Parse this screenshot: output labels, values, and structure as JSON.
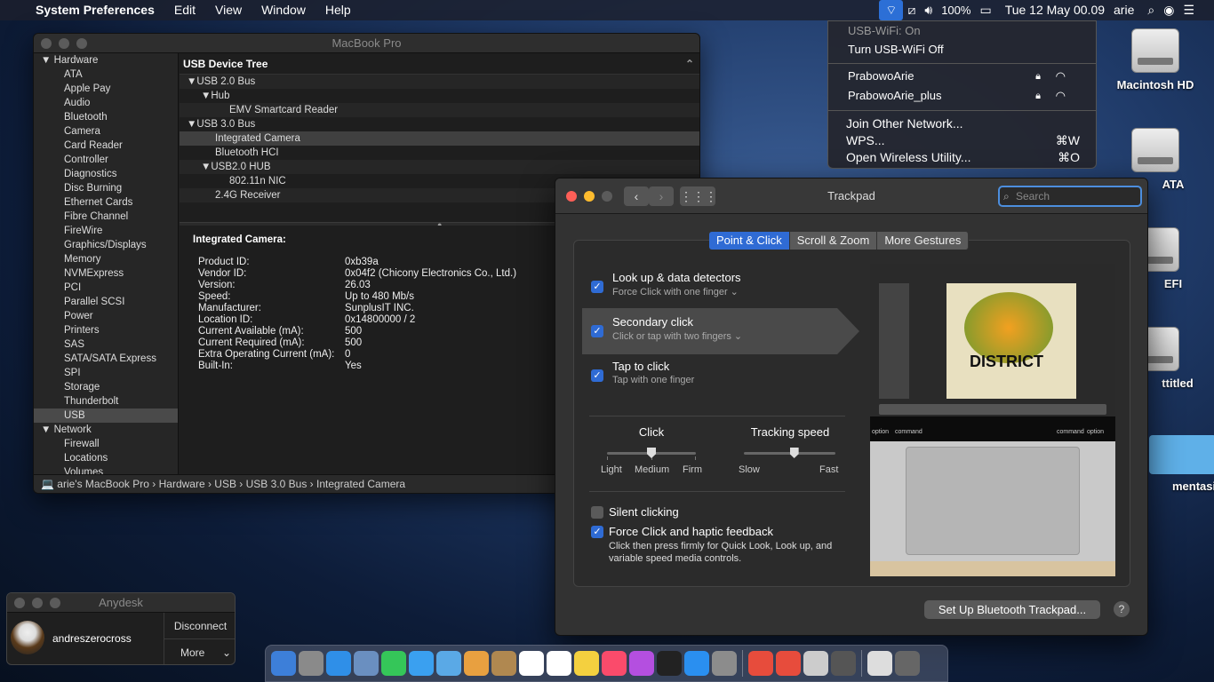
{
  "menubar": {
    "apple": "",
    "app": "System Preferences",
    "menus": [
      "Edit",
      "View",
      "Window",
      "Help"
    ],
    "battery": "100%",
    "clock": "Tue 12 May  00.09",
    "user": "arie"
  },
  "desktop": {
    "icons": [
      "Macintosh HD",
      "ATA",
      "EFI",
      "ttitled",
      "mentasi"
    ]
  },
  "wifi_menu": {
    "status": "USB-WiFi: On",
    "toggle": "Turn USB-WiFi Off",
    "networks": [
      "PrabowoArie",
      "PrabowoArie_plus"
    ],
    "join": "Join Other Network...",
    "wps": "WPS...",
    "wps_shortcut": "⌘W",
    "open": "Open Wireless Utility...",
    "open_shortcut": "⌘O"
  },
  "sysinfo": {
    "title": "MacBook Pro",
    "sidebar": {
      "hardware": "Hardware",
      "hardware_items": [
        "ATA",
        "Apple Pay",
        "Audio",
        "Bluetooth",
        "Camera",
        "Card Reader",
        "Controller",
        "Diagnostics",
        "Disc Burning",
        "Ethernet Cards",
        "Fibre Channel",
        "FireWire",
        "Graphics/Displays",
        "Memory",
        "NVMExpress",
        "PCI",
        "Parallel SCSI",
        "Power",
        "Printers",
        "SAS",
        "SATA/SATA Express",
        "SPI",
        "Storage",
        "Thunderbolt",
        "USB"
      ],
      "network": "Network",
      "network_items": [
        "Firewall",
        "Locations",
        "Volumes"
      ]
    },
    "tree_header": "USB Device Tree",
    "tree": [
      {
        "label": "▼USB 2.0 Bus",
        "indent": 0
      },
      {
        "label": "▼Hub",
        "indent": 1
      },
      {
        "label": "EMV Smartcard Reader",
        "indent": 3
      },
      {
        "label": "▼USB 3.0 Bus",
        "indent": 0
      },
      {
        "label": "Integrated Camera",
        "indent": 2
      },
      {
        "label": "Bluetooth HCI",
        "indent": 2
      },
      {
        "label": "▼USB2.0 HUB",
        "indent": 1
      },
      {
        "label": "802.11n NIC",
        "indent": 3
      },
      {
        "label": "2.4G Receiver",
        "indent": 2
      }
    ],
    "detail_title": "Integrated Camera:",
    "details": [
      {
        "k": "Product ID:",
        "v": "0xb39a"
      },
      {
        "k": "Vendor ID:",
        "v": "0x04f2  (Chicony Electronics Co., Ltd.)"
      },
      {
        "k": "Version:",
        "v": "26.03"
      },
      {
        "k": "Speed:",
        "v": "Up to 480 Mb/s"
      },
      {
        "k": "Manufacturer:",
        "v": "SunplusIT INC."
      },
      {
        "k": "Location ID:",
        "v": "0x14800000 / 2"
      },
      {
        "k": "Current Available (mA):",
        "v": "500"
      },
      {
        "k": "Current Required (mA):",
        "v": "500"
      },
      {
        "k": "Extra Operating Current (mA):",
        "v": "0"
      },
      {
        "k": "Built-In:",
        "v": "Yes"
      }
    ],
    "path": "💻 arie's MacBook Pro › Hardware › USB › USB 3.0 Bus › Integrated Camera"
  },
  "trackpad": {
    "title": "Trackpad",
    "search_placeholder": "Search",
    "tabs": [
      "Point & Click",
      "Scroll & Zoom",
      "More Gestures"
    ],
    "options": [
      {
        "label": "Look up & data detectors",
        "sub": "Force Click with one finger ⌄",
        "checked": true
      },
      {
        "label": "Secondary click",
        "sub": "Click or tap with two fingers ⌄",
        "checked": true
      },
      {
        "label": "Tap to click",
        "sub": "Tap with one finger",
        "checked": true
      }
    ],
    "click": {
      "label": "Click",
      "ticks": [
        "Light",
        "Medium",
        "Firm"
      ],
      "level": 0.5
    },
    "tracking": {
      "label": "Tracking speed",
      "min": "Slow",
      "max": "Fast",
      "level": 0.55
    },
    "silent": {
      "label": "Silent clicking",
      "checked": false
    },
    "force": {
      "label": "Force Click and haptic feedback",
      "sub": "Click then press firmly for Quick Look, Look up, and variable speed media controls.",
      "checked": true
    },
    "preview_text": "DISTRICT",
    "keys": [
      "option",
      "command",
      "command",
      "option"
    ],
    "bt_button": "Set Up Bluetooth Trackpad...",
    "help": "?"
  },
  "anydesk": {
    "title": "Anydesk",
    "user": "andreszerocross",
    "disconnect": "Disconnect",
    "more": "More"
  },
  "dock": {
    "colors": [
      "#3d7fd9",
      "#8a8a8a",
      "#2f8fe8",
      "#6a8fc0",
      "#35c659",
      "#3aa0f0",
      "#5aa9e6",
      "#e8a040",
      "#b08850",
      "#ffffff",
      "#ffffff",
      "#f4d03f",
      "#fa4b6b",
      "#b44fe0",
      "#222222",
      "#2a8ff0",
      "#8c8c8c",
      "#e74c3c",
      "#e74c3c",
      "#cccccc",
      "#555555",
      "#dddddd",
      "#666666"
    ]
  }
}
